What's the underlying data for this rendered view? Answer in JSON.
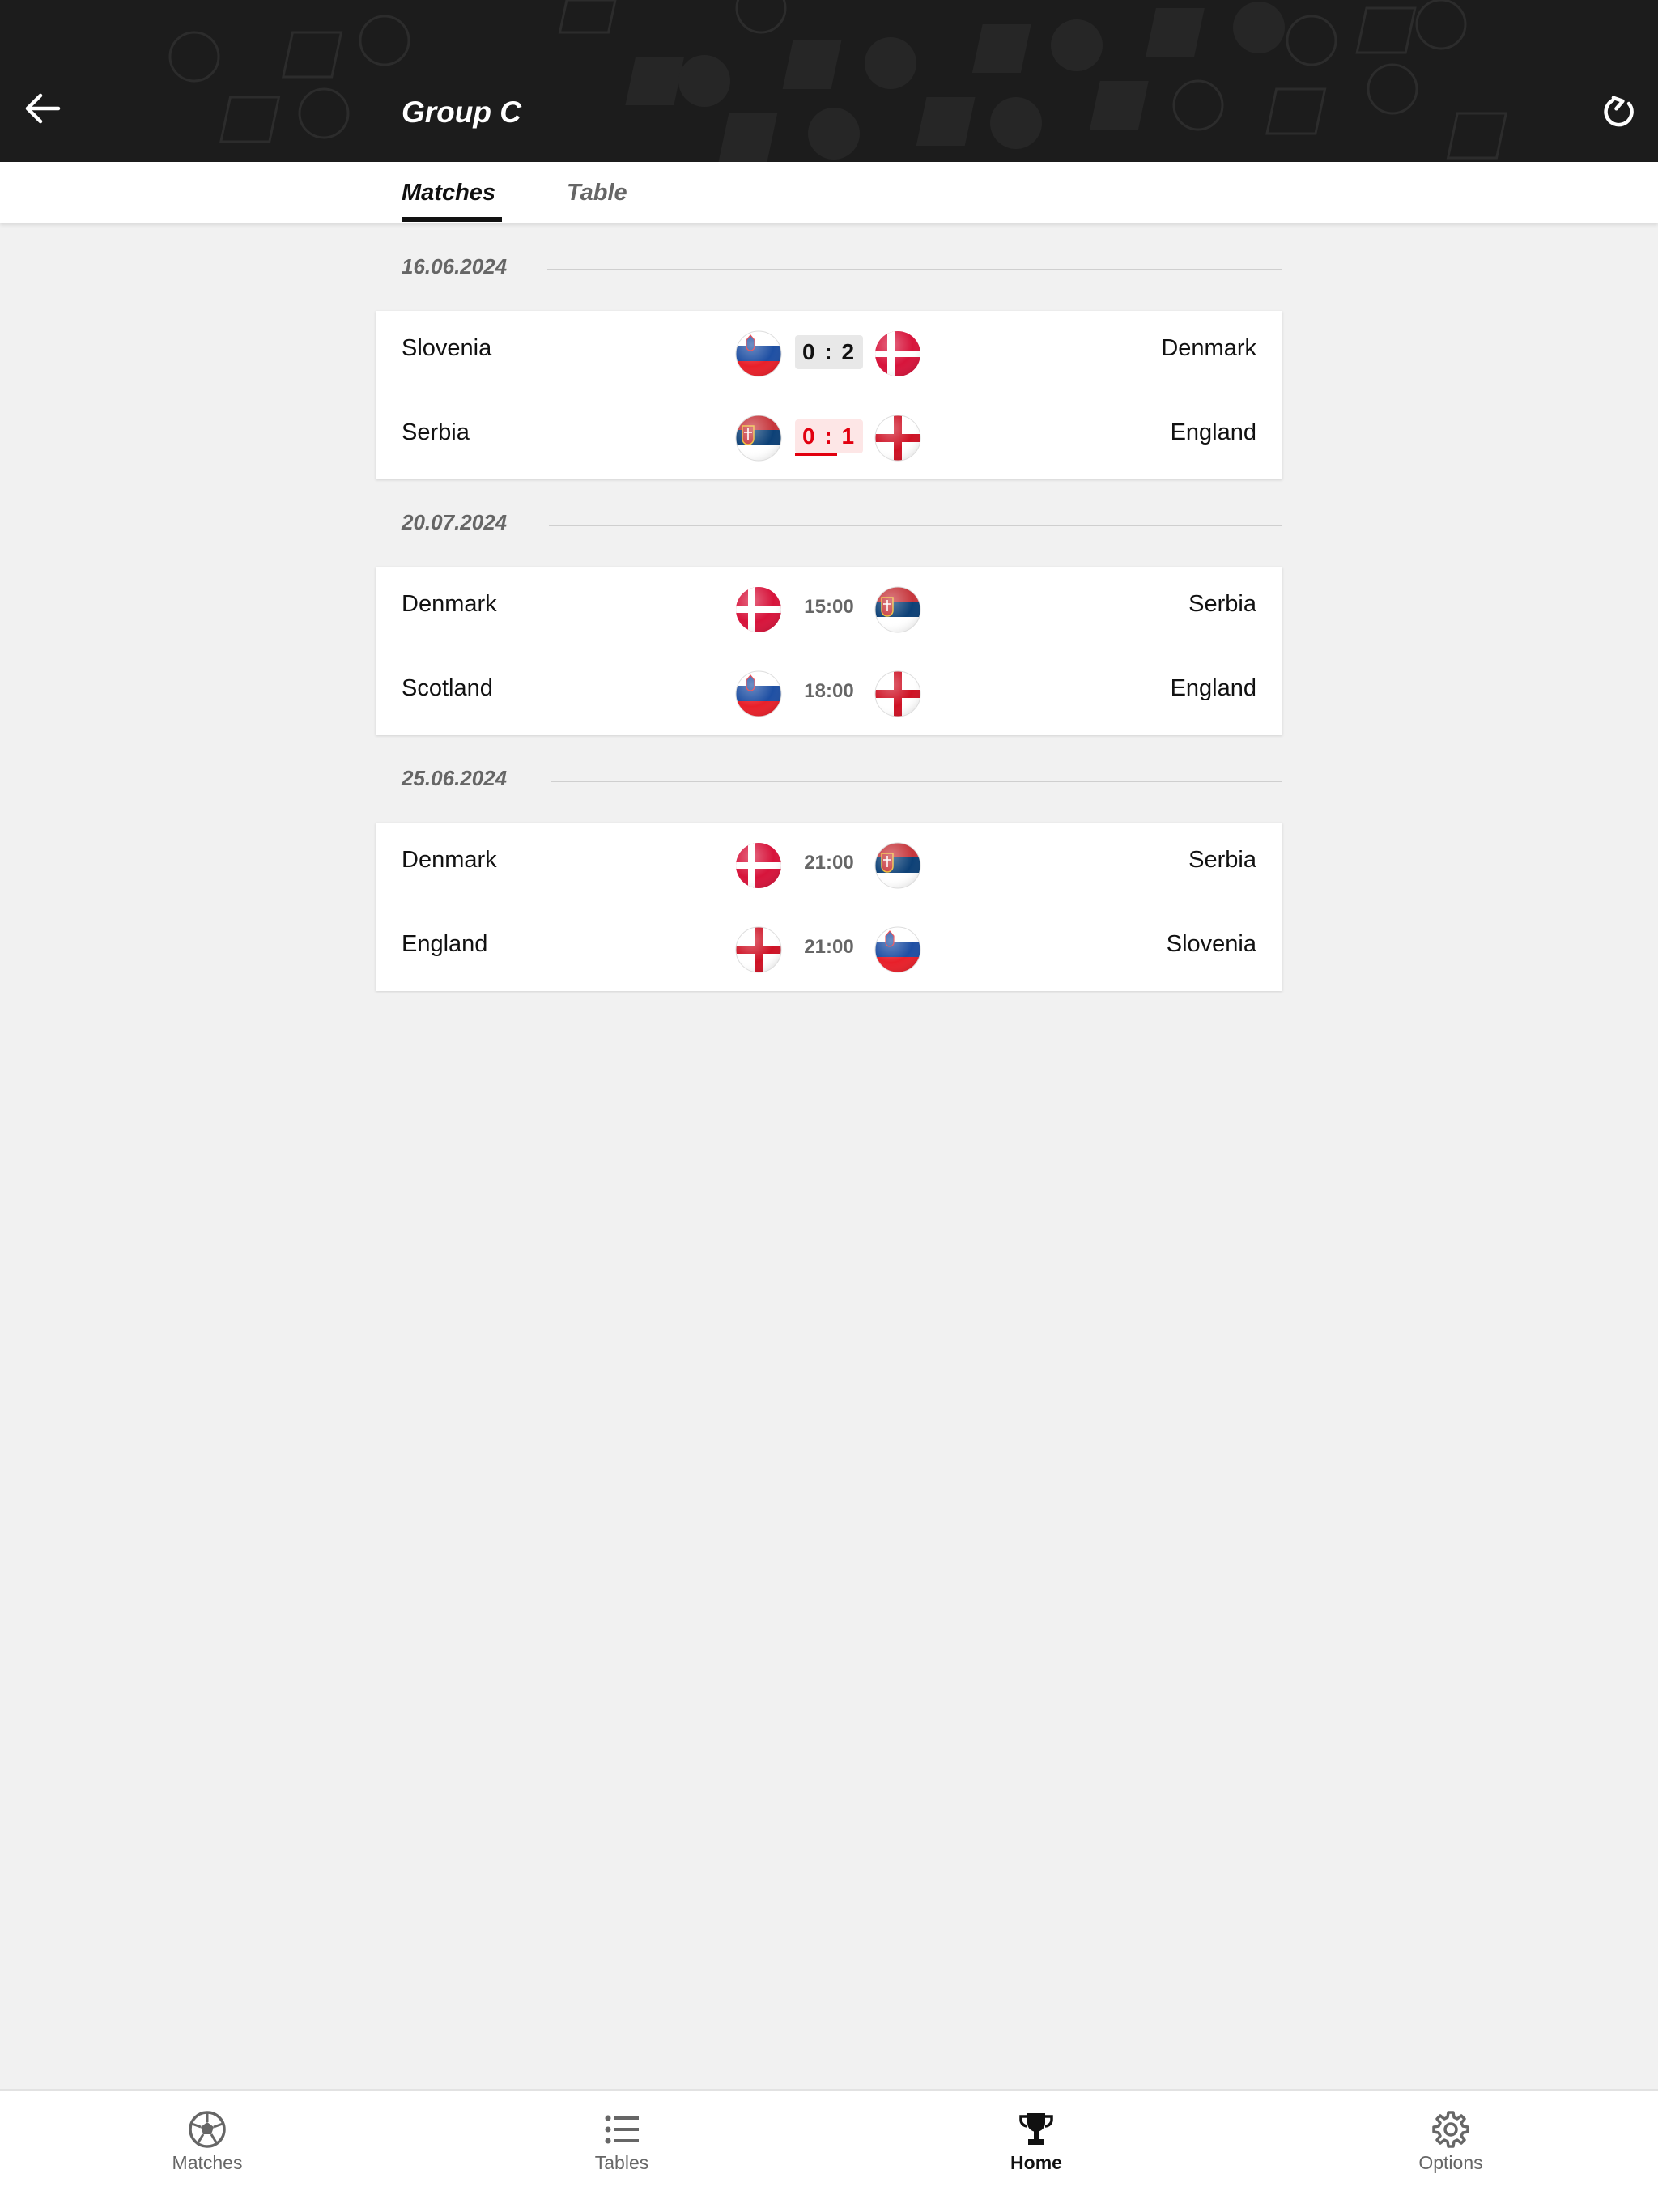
{
  "header": {
    "title": "Group C",
    "back_icon": "arrow-left-icon",
    "refresh_icon": "refresh-icon"
  },
  "tabs": [
    {
      "label": "Matches",
      "active": true
    },
    {
      "label": "Table",
      "active": false
    }
  ],
  "days": [
    {
      "date": "16.06.2024",
      "matches": [
        {
          "home": "Slovenia",
          "home_flag": "slovenia-flag-icon",
          "result": "0 : 2",
          "status": "finished",
          "away": "Denmark",
          "away_flag": "denmark-flag-icon"
        },
        {
          "home": "Serbia",
          "home_flag": "serbia-flag-icon",
          "result": "0 : 1",
          "status": "live",
          "away": "England",
          "away_flag": "england-flag-icon"
        }
      ]
    },
    {
      "date": "20.07.2024",
      "matches": [
        {
          "home": "Denmark",
          "home_flag": "denmark-flag-icon",
          "result": "15:00",
          "status": "scheduled",
          "away": "Serbia",
          "away_flag": "serbia-flag-icon"
        },
        {
          "home": "Scotland",
          "home_flag": "slovenia-flag-icon",
          "result": "18:00",
          "status": "scheduled",
          "away": "England",
          "away_flag": "england-flag-icon"
        }
      ]
    },
    {
      "date": "25.06.2024",
      "matches": [
        {
          "home": "Denmark",
          "home_flag": "denmark-flag-icon",
          "result": "21:00",
          "status": "scheduled",
          "away": "Serbia",
          "away_flag": "serbia-flag-icon"
        },
        {
          "home": "England",
          "home_flag": "england-flag-icon",
          "result": "21:00",
          "status": "scheduled",
          "away": "Slovenia",
          "away_flag": "slovenia-flag-icon"
        }
      ]
    }
  ],
  "bottom_nav": [
    {
      "label": "Matches",
      "icon": "soccer-ball-icon",
      "active": false
    },
    {
      "label": "Tables",
      "icon": "list-icon",
      "active": false
    },
    {
      "label": "Home",
      "icon": "trophy-icon",
      "active": true
    },
    {
      "label": "Options",
      "icon": "gear-icon",
      "active": false
    }
  ],
  "colors": {
    "header_bg": "#1c1c1c",
    "live_red": "#e2000f",
    "page_bg": "#f1f1f1"
  }
}
